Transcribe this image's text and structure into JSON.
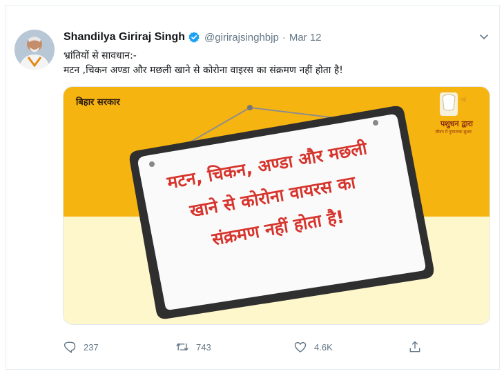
{
  "tweet": {
    "display_name": "Shandilya Giriraj Singh",
    "handle": "@girirajsinghbjp",
    "separator": "·",
    "date": "Mar 12",
    "text_line1": "भ्रांतियों से सावधान:-",
    "text_line2": "मटन ,चिकन अण्डा और मछली खाने से कोरोना वाइरस का संक्रमण नहीं होता है!"
  },
  "media": {
    "gov_label": "बिहार सरकार",
    "dept_label": "पशुधन द्वारा",
    "dept_subtitle": "जीवन में गुणात्मक सुधार",
    "sign_line1": "मटन, चिकन, अण्डा और मछली",
    "sign_line2": "खाने से कोरोना वायरस का",
    "sign_line3": "संक्रमण नहीं होता है!"
  },
  "actions": {
    "reply_count": "237",
    "retweet_count": "743",
    "like_count": "4.6K"
  },
  "icons": {
    "verified": "verified-badge-icon",
    "chevron": "chevron-down-icon",
    "reply": "reply-icon",
    "retweet": "retweet-icon",
    "like": "heart-icon",
    "share": "share-icon"
  },
  "colors": {
    "verified_blue": "#1da1f2",
    "media_yellow": "#f6b411",
    "media_cream": "#fff7cc",
    "sign_text_red": "#d6342c",
    "muted_gray": "#657786"
  }
}
